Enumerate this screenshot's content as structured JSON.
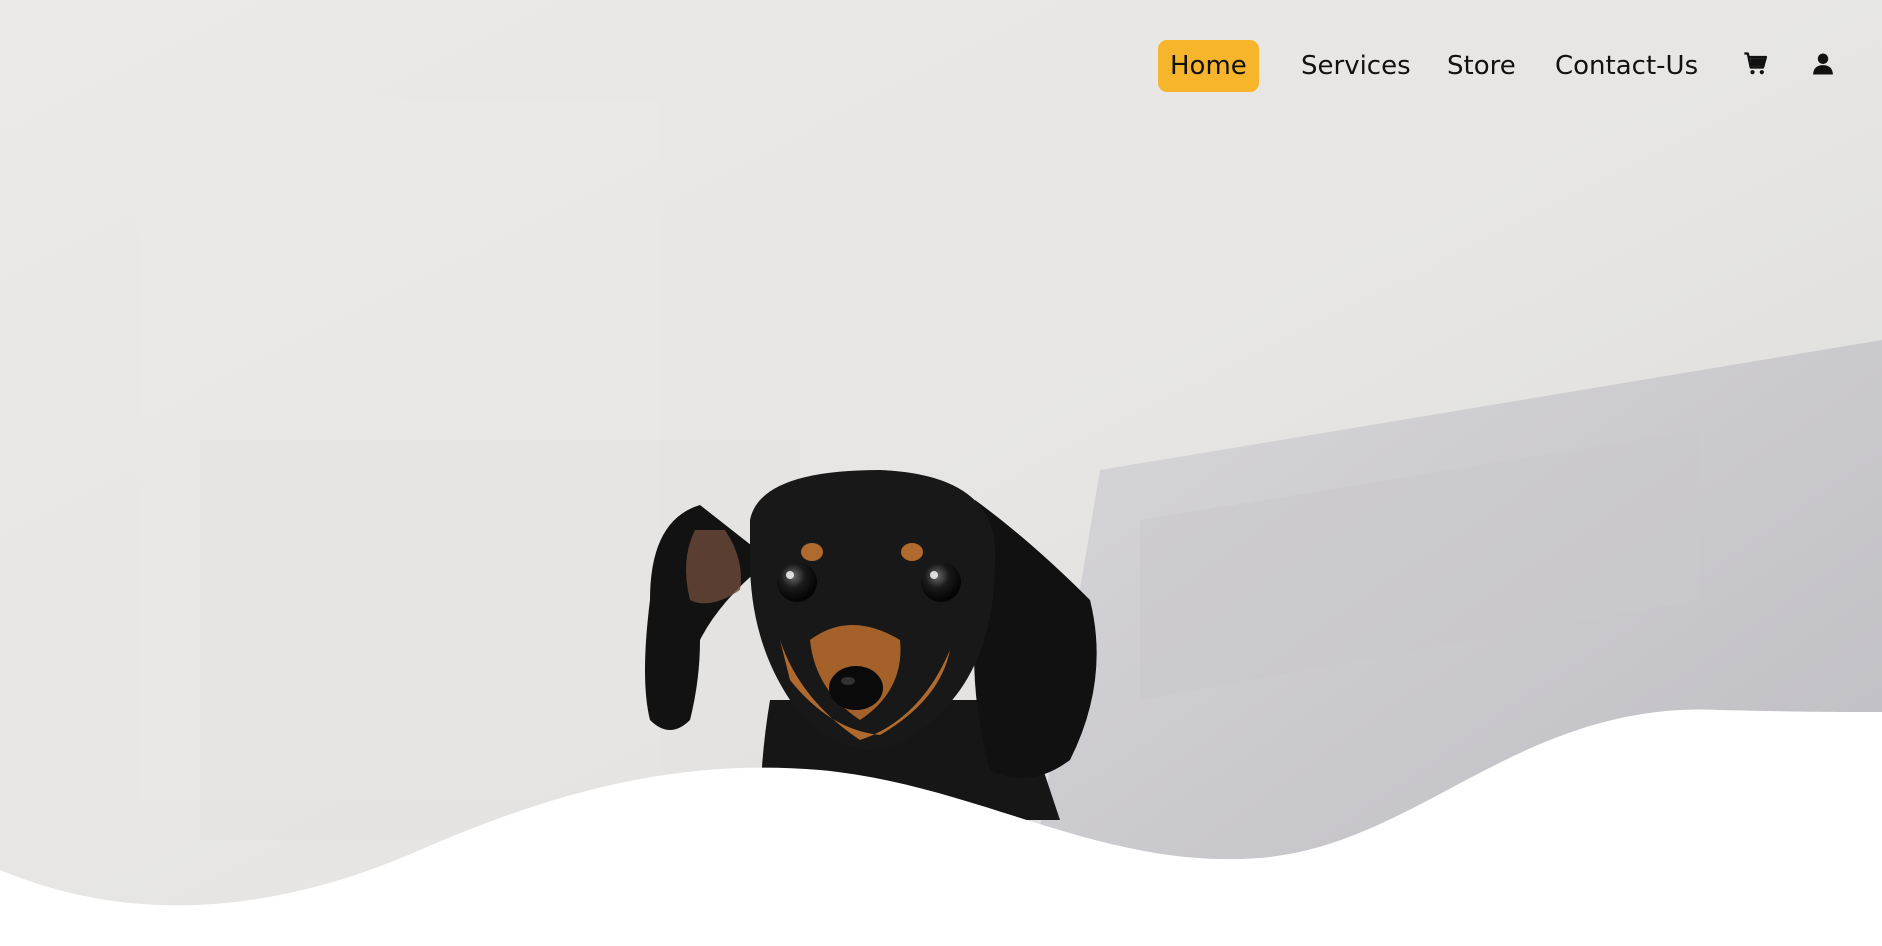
{
  "nav": {
    "items": [
      {
        "label": "Home",
        "active": true
      },
      {
        "label": "Services",
        "active": false
      },
      {
        "label": "Store",
        "active": false
      },
      {
        "label": "Contact-Us",
        "active": false
      }
    ],
    "icons": [
      "cart-icon",
      "user-icon"
    ]
  },
  "hero": {
    "image": "dachshund-puppy-photo",
    "subject": "black and tan puppy peeking up"
  },
  "colors": {
    "accent": "#f7b52c",
    "text": "#111111",
    "background_light": "#e7e6e4",
    "wave": "#ffffff"
  }
}
